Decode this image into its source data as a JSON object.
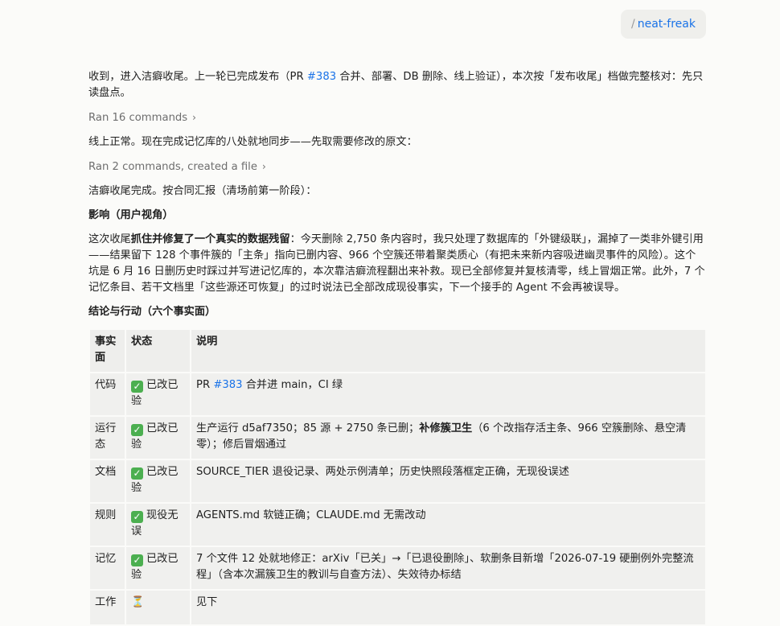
{
  "chip": {
    "slash": "/",
    "command": "neat-freak"
  },
  "intro": {
    "part1": "收到，进入洁癖收尾。上一轮已完成发布（PR ",
    "pr_link": "#383",
    "part2": " 合并、部署、DB 删除、线上验证），本次按「发布收尾」档做完整核对：先只读盘点。"
  },
  "expander1": {
    "label": "Ran 16 commands",
    "chevron": "›"
  },
  "para2": "线上正常。现在完成记忆库的八处就地同步——先取需要修改的原文：",
  "expander2": {
    "label": "Ran 2 commands, created a file",
    "chevron": "›"
  },
  "para3": "洁癖收尾完成。按合同汇报（清场前第一阶段）：",
  "heading_impact": "影响（用户视角）",
  "impact": {
    "lead": "这次收尾",
    "bold": "抓住并修复了一个真实的数据残留",
    "rest": "：今天删除 2,750 条内容时，我只处理了数据库的「外键级联」，漏掉了一类非外键引用——结果留下 128 个事件簇的「主条」指向已删内容、966 个空簇还带着聚类质心（有把未来新内容吸进幽灵事件的风险）。这个坑是 6 月 16 日删历史时踩过并写进记忆库的，本次靠洁癖流程翻出来补救。现已全部修复并复核清零，线上冒烟正常。此外，7 个记忆条目、若干文档里「这些源还可恢复」的过时说法已全部改成现役事实，下一个接手的 Agent 不会再被误导。"
  },
  "heading_conclusion": "结论与行动（六个事实面）",
  "table": {
    "headers": [
      "事实面",
      "状态",
      "说明"
    ],
    "rows": [
      {
        "facet": "代码",
        "check": "✓",
        "status": "已改已验",
        "desc_pre": "PR ",
        "desc_link": "#383",
        "desc_bold": "",
        "desc_post": " 合并进 main，CI 绿"
      },
      {
        "facet": "运行态",
        "check": "✓",
        "status": "已改已验",
        "desc_pre": "生产运行 d5af7350；85 源 + 2750 条已删；",
        "desc_link": "",
        "desc_bold": "补修簇卫生",
        "desc_post": "（6 个改指存活主条、966 空簇删除、悬空清零）；修后冒烟通过"
      },
      {
        "facet": "文档",
        "check": "✓",
        "status": "已改已验",
        "desc_pre": "SOURCE_TIER 退役记录、两处示例清单；历史快照段落框定正确，无现役误述",
        "desc_link": "",
        "desc_bold": "",
        "desc_post": ""
      },
      {
        "facet": "规则",
        "check": "✓",
        "status": "现役无误",
        "desc_pre": "AGENTS.md 软链正确；CLAUDE.md 无需改动",
        "desc_link": "",
        "desc_bold": "",
        "desc_post": ""
      },
      {
        "facet": "记忆",
        "check": "✓",
        "status": "已改已验",
        "desc_pre": "7 个文件 12 处就地修正：arXiv「已关」→「已退役删除」、软删条目新增「2026-07-19 硬删例外完整流程」（含本次漏簇卫生的教训与自查方法）、失效待办标结",
        "desc_link": "",
        "desc_bold": "",
        "desc_post": ""
      },
      {
        "facet": "工作",
        "check": "⏳",
        "status": "",
        "desc_pre": "见下",
        "desc_link": "",
        "desc_bold": "",
        "desc_post": ""
      }
    ]
  }
}
